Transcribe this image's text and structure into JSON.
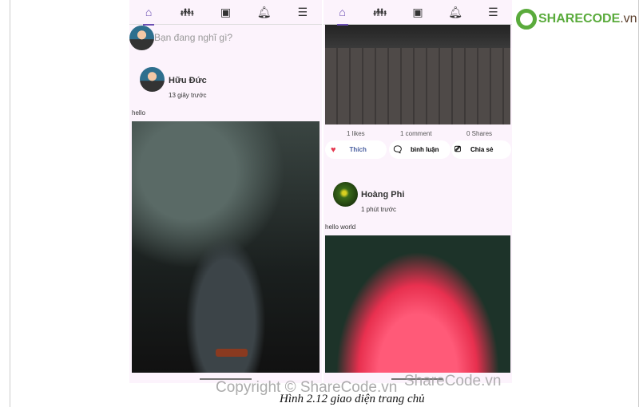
{
  "left_phone": {
    "nav": [
      "home-icon",
      "family-icon",
      "video-icon",
      "bell-icon",
      "menu-icon"
    ],
    "composer_placeholder": "Bạn đang nghĩ gì?",
    "post": {
      "author": "Hữu Đức",
      "time": "13 giây trước",
      "text": "hello"
    }
  },
  "right_phone": {
    "nav": [
      "home-icon",
      "family-icon",
      "video-icon",
      "bell-icon",
      "menu-icon"
    ],
    "stats": {
      "likes": "1 likes",
      "comments": "1 comment",
      "shares": "0 Shares"
    },
    "actions": {
      "like": "Thích",
      "comment": "bình luận",
      "share": "Chia sẻ"
    },
    "post": {
      "author": "Hoàng Phi",
      "time": "1 phút trước",
      "text": "hello world"
    }
  },
  "logo": {
    "brand": "SHARECODE",
    "tld": ".vn"
  },
  "watermark": "Copyright © ShareCode.vn",
  "watermark2": "ShareCode.vn",
  "caption": "Hình 2.12 giao diện trang chủ",
  "colors": {
    "accent": "#6b4fb3",
    "like": "#e53950",
    "brand_green": "#5aab3c"
  }
}
